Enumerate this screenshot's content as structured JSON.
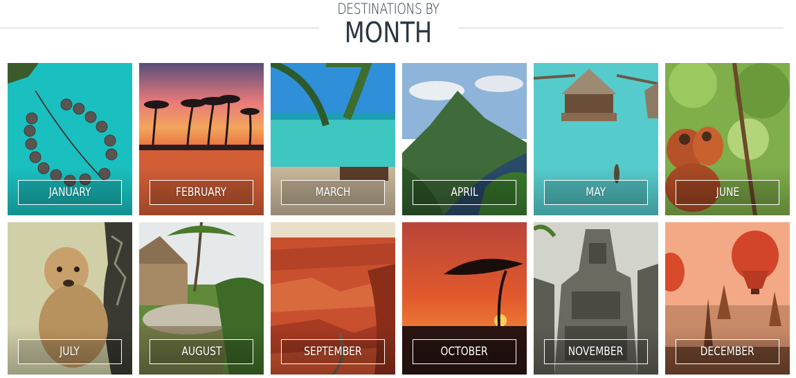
{
  "header": {
    "title_line1": "DESTINATIONS BY",
    "title_line2": "MONTH"
  },
  "months": [
    {
      "label": "JANUARY"
    },
    {
      "label": "FEBRUARY"
    },
    {
      "label": "MARCH"
    },
    {
      "label": "APRIL"
    },
    {
      "label": "MAY"
    },
    {
      "label": "JUNE"
    },
    {
      "label": "JULY"
    },
    {
      "label": "AUGUST"
    },
    {
      "label": "SEPTEMBER"
    },
    {
      "label": "OCTOBER"
    },
    {
      "label": "NOVEMBER"
    },
    {
      "label": "DECEMBER"
    }
  ],
  "colors": {
    "title": "#2b3542",
    "divider": "#cfcfcf",
    "label_border": "#ffffff"
  }
}
